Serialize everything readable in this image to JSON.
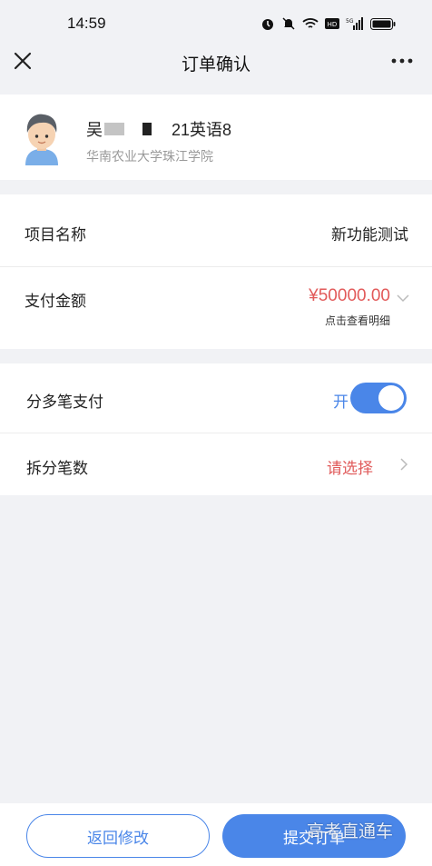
{
  "status_bar": {
    "time": "14:59"
  },
  "nav": {
    "title": "订单确认"
  },
  "user": {
    "surname": "吴",
    "class": "21英语8",
    "school": "华南农业大学珠江学院"
  },
  "order": {
    "project_label": "项目名称",
    "project_value": "新功能测试",
    "amount_label": "支付金额",
    "amount_value": "¥50000.00",
    "detail_link": "点击查看明细"
  },
  "payment": {
    "split_label": "分多笔支付",
    "split_state": "开",
    "count_label": "拆分笔数",
    "count_value": "请选择"
  },
  "footer": {
    "back_label": "返回修改",
    "submit_label": "提交订单"
  },
  "watermark": "高考直通车",
  "colors": {
    "accent": "#4a86e8",
    "price": "#e25a5a",
    "background": "#f1f2f5"
  }
}
